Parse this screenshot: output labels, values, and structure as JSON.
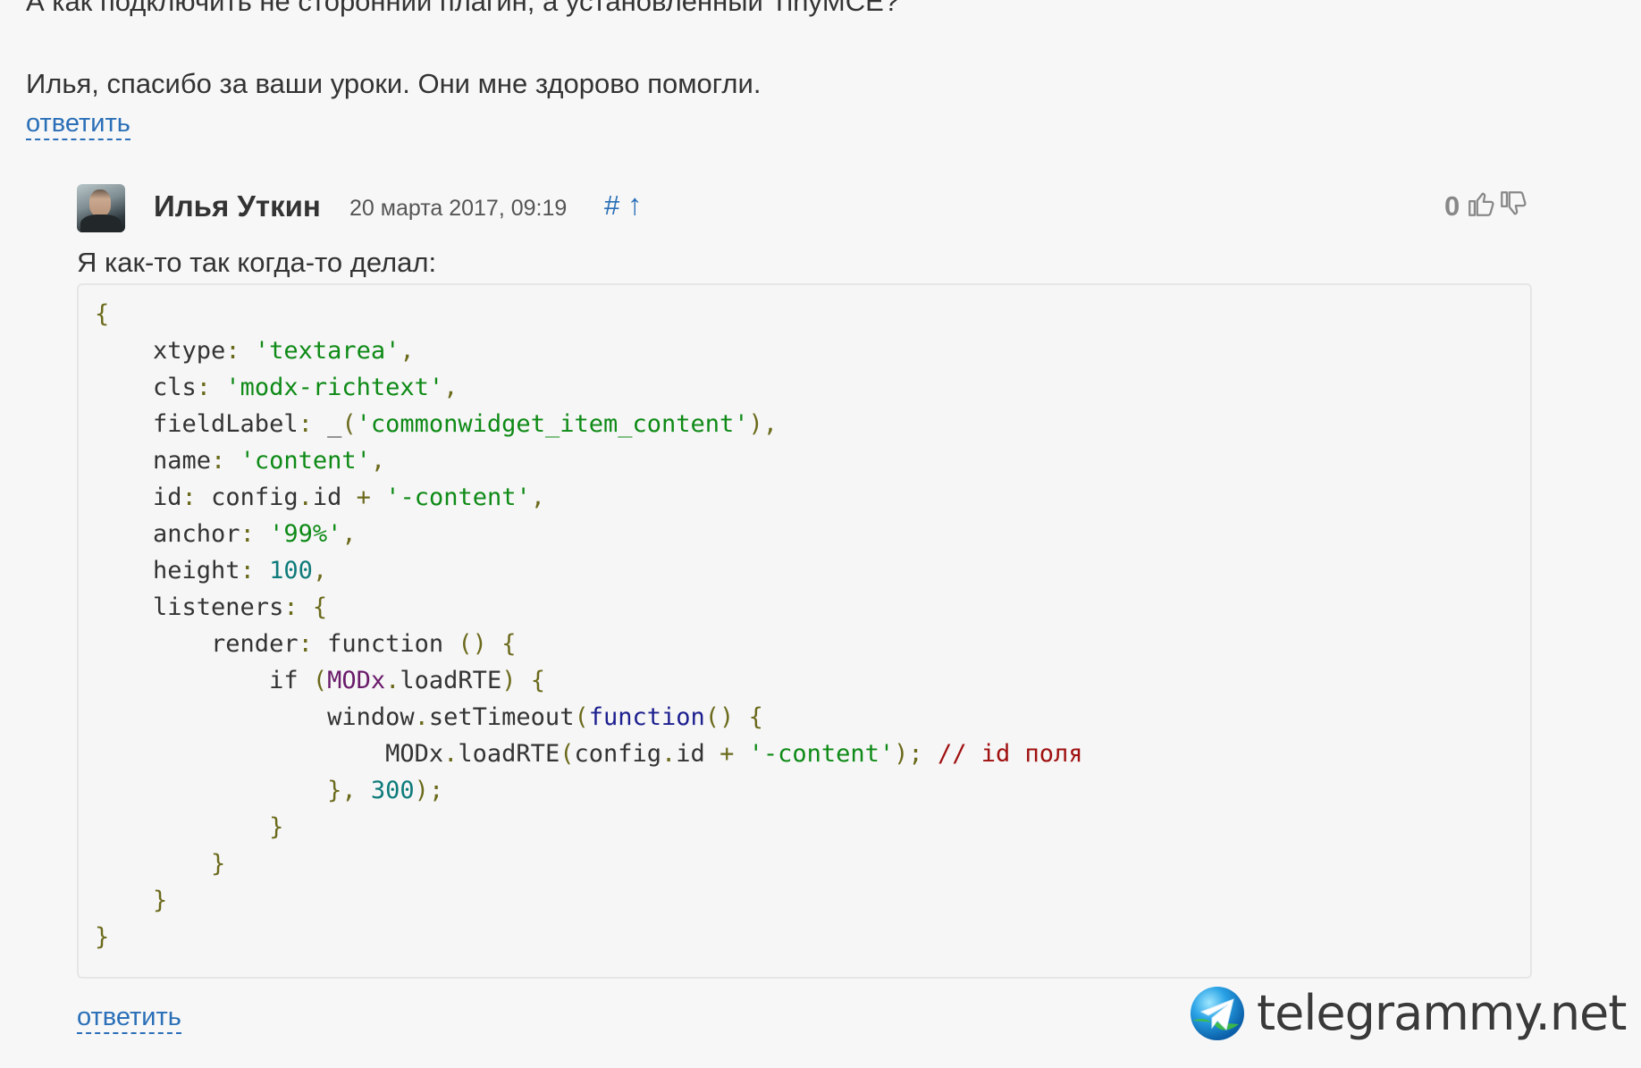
{
  "previous_comment": {
    "cut_text": "А как подключить не сторонний плагин, а установленный TinyMCE?",
    "text": "Илья, спасибо за ваши уроки. Они мне здорово помогли.",
    "reply_label": "ответить"
  },
  "comment": {
    "author": "Илья Уткин",
    "date": "20 марта 2017, 09:19",
    "anchor_hash": "#",
    "anchor_up": "↑",
    "votes": "0",
    "text": "Я как-то так когда-то делал:",
    "reply_label": "ответить",
    "code_lines": [
      "{",
      "    xtype: 'textarea',",
      "    cls: 'modx-richtext',",
      "    fieldLabel: _('commonwidget_item_content'),",
      "    name: 'content',",
      "    id: config.id + '-content',",
      "    anchor: '99%',",
      "    height: 100,",
      "    listeners: {",
      "        render: function () {",
      "            if (MODx.loadRTE) {",
      "                window.setTimeout(function() {",
      "                    MODx.loadRTE(config.id + '-content'); // id поля",
      "                }, 300);",
      "            }",
      "        }",
      "    }",
      "}"
    ]
  },
  "icons": {
    "thumb_up": "thumb-up-icon",
    "thumb_down": "thumb-down-icon",
    "avatar": "user-avatar",
    "watermark": "telegram-paper-plane-icon"
  },
  "watermark": {
    "text": "telegrammy.net"
  },
  "colors": {
    "link": "#2a6fb7",
    "string": "#0e8a16",
    "number": "#0f7b7b",
    "keyword": "#1c1f8f",
    "comment": "#a01010"
  }
}
